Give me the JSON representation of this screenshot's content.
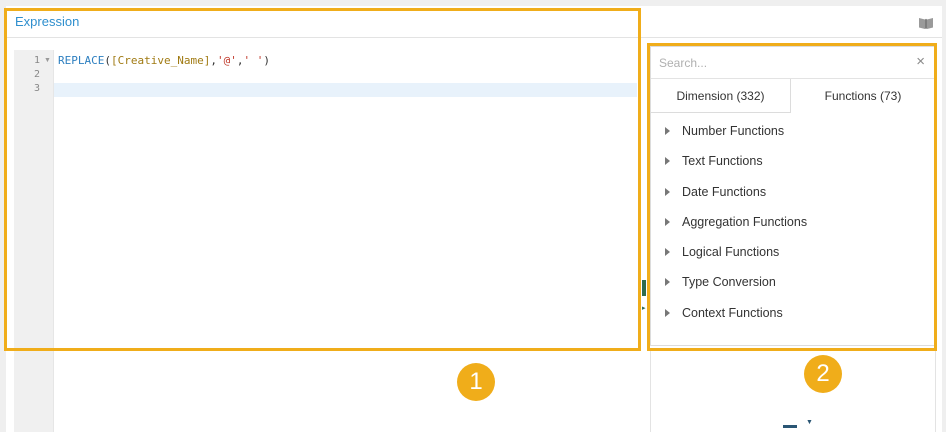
{
  "header": {
    "title": "Expression"
  },
  "editor": {
    "line_numbers": [
      "1",
      "2",
      "3"
    ],
    "line1": {
      "fn": "REPLACE",
      "open": "(",
      "field": "[Creative_Name]",
      "sep1": ",",
      "str1": "'@'",
      "sep2": ",",
      "str2": "' '",
      "close": ")"
    }
  },
  "functions_panel": {
    "search_placeholder": "Search...",
    "close_icon": "×",
    "tabs": [
      {
        "label": "Dimension (332)"
      },
      {
        "label": "Functions (73)"
      }
    ],
    "categories": [
      {
        "label": "Number Functions"
      },
      {
        "label": "Text Functions"
      },
      {
        "label": "Date Functions"
      },
      {
        "label": "Aggregation Functions"
      },
      {
        "label": "Logical Functions"
      },
      {
        "label": "Type Conversion"
      },
      {
        "label": "Context Functions"
      }
    ]
  },
  "callouts": {
    "one": "1",
    "two": "2"
  },
  "colors": {
    "accent": "#2f8fce",
    "highlight": "#f0ad1a"
  }
}
